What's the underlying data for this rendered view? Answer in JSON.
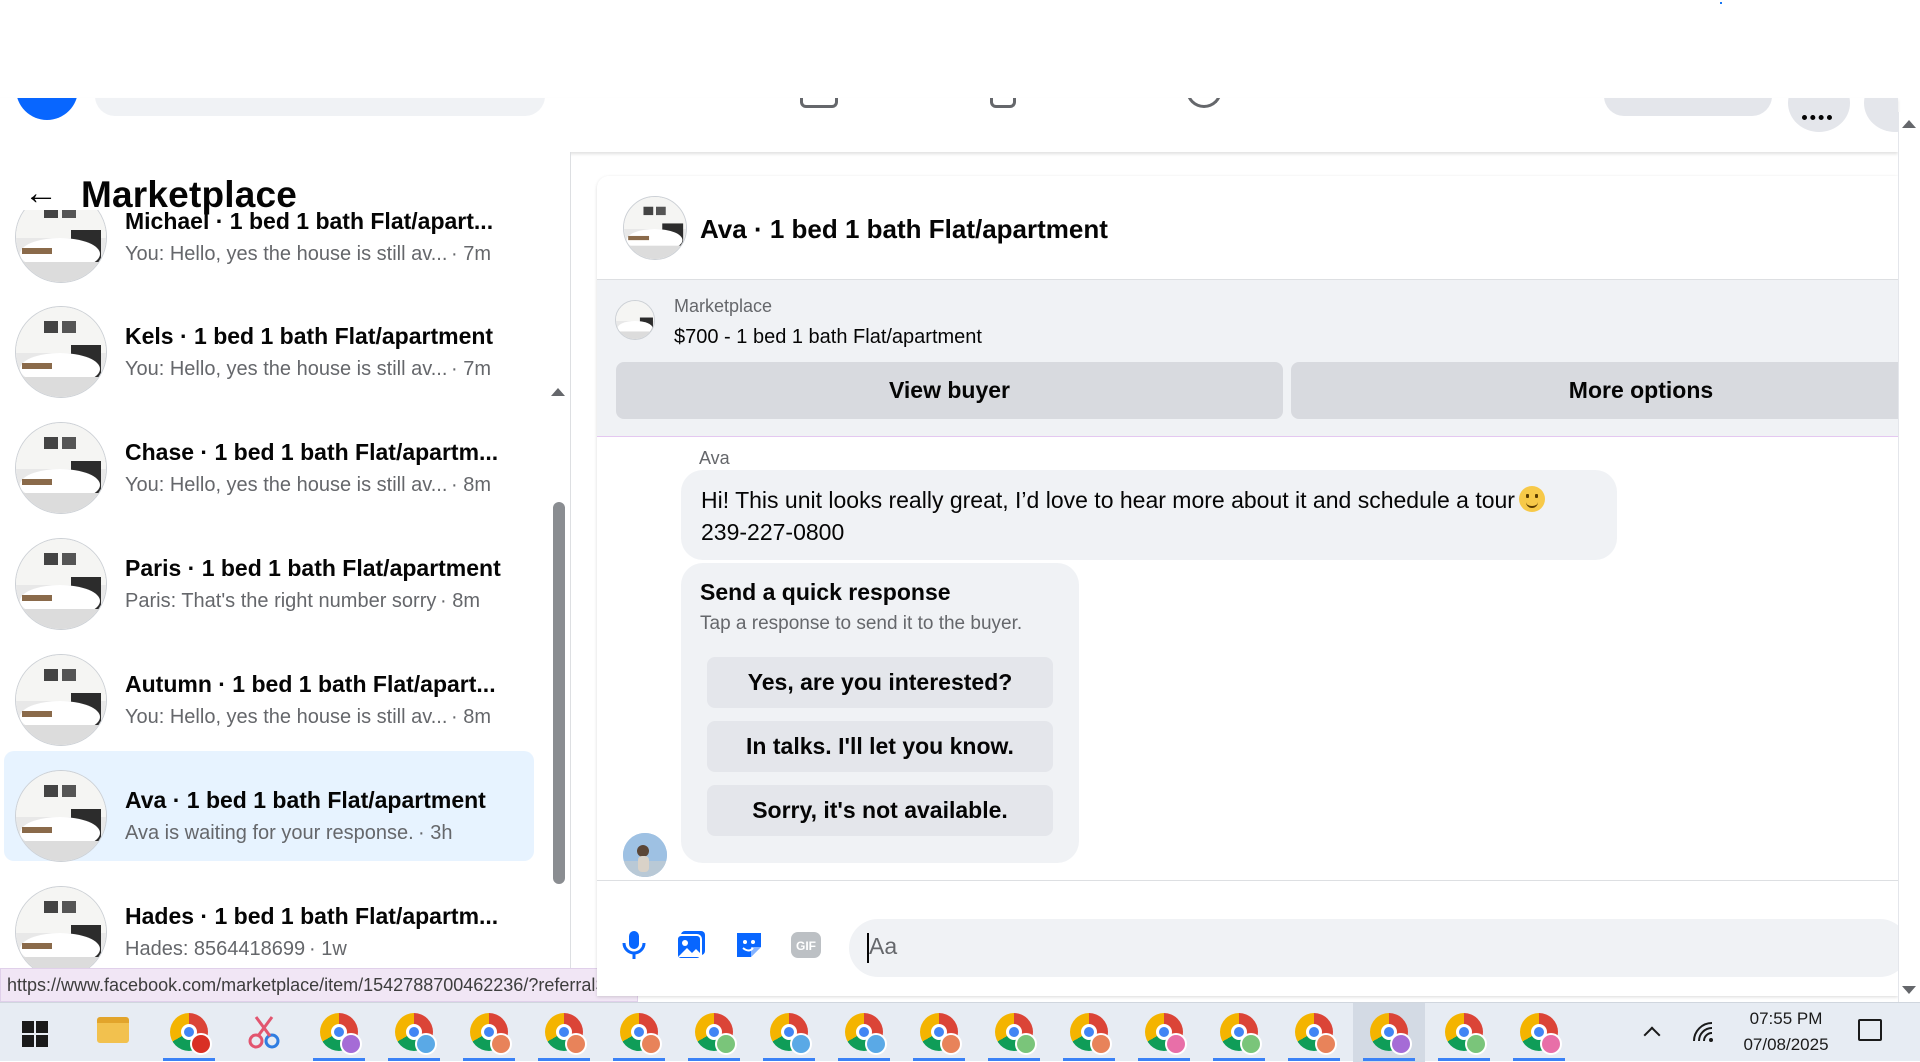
{
  "panel": {
    "title": "Marketplace"
  },
  "conversations": [
    {
      "name": "Michael · 1 bed 1 bath Flat/apart...",
      "preview": "You: Hello, yes the house is still av...",
      "time": "· 7m"
    },
    {
      "name": "Kels · 1 bed 1 bath Flat/apartment",
      "preview": "You: Hello, yes the house is still av...",
      "time": "· 7m"
    },
    {
      "name": "Chase · 1 bed 1 bath Flat/apartm...",
      "preview": "You: Hello, yes the house is still av...",
      "time": "· 8m"
    },
    {
      "name": "Paris · 1 bed 1 bath Flat/apartment",
      "preview": "Paris: That's the right number sorry",
      "time": "· 8m"
    },
    {
      "name": "Autumn · 1 bed 1 bath Flat/apart...",
      "preview": "You: Hello, yes the house is still av...",
      "time": "· 8m"
    },
    {
      "name": "Ava · 1 bed 1 bath Flat/apartment",
      "preview": "Ava is waiting for your response.",
      "time": "· 3h"
    },
    {
      "name": "Hades · 1 bed 1 bath Flat/apartm...",
      "preview": "Hades: 8564418699",
      "time": "· 1w"
    }
  ],
  "status_url": "https://www.facebook.com/marketplace/item/1542788700462236/?referralS...",
  "chat": {
    "title": "Ava · 1 bed 1 bath Flat/apartment",
    "listing_label": "Marketplace",
    "listing_price": "$700 - 1 bed 1 bath Flat/apartment",
    "view_buyer_label": "View buyer",
    "more_options_label": "More options",
    "sender": "Ava",
    "message_line1": "Hi! This unit looks really great, I’d love to hear more about it and schedule a tour",
    "message_line2": "239-227-0800",
    "quick_title": "Send a quick response",
    "quick_subtitle": "Tap a response to send it to the buyer.",
    "quick_options": [
      "Yes, are you interested?",
      "In talks. I'll let you know.",
      "Sorry, it's not available."
    ],
    "composer_placeholder": "Aa"
  },
  "taskbar": {
    "time": "07:55 PM",
    "date": "07/08/2025"
  },
  "colors": {
    "facebook_blue": "#0866ff",
    "active_row": "#e7f3ff",
    "bubble_gray": "#f0f2f5",
    "button_gray": "#d8dadf"
  }
}
